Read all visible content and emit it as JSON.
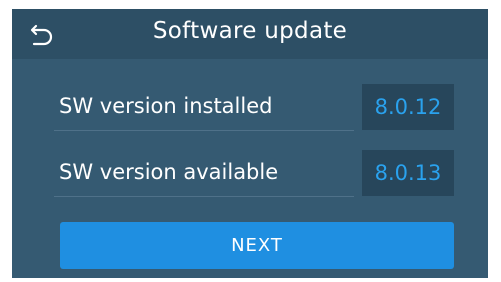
{
  "header": {
    "title": "Software update",
    "back_icon": "back-arrow-icon"
  },
  "rows": [
    {
      "label": "SW version installed",
      "value": "8.0.12"
    },
    {
      "label": "SW version available",
      "value": "8.0.13"
    }
  ],
  "next_button": {
    "label": "NEXT"
  },
  "colors": {
    "background": "#355a72",
    "header": "#2d4f65",
    "value_box": "#27465b",
    "value_text": "#2aa2ee",
    "button": "#1f8fe1"
  }
}
